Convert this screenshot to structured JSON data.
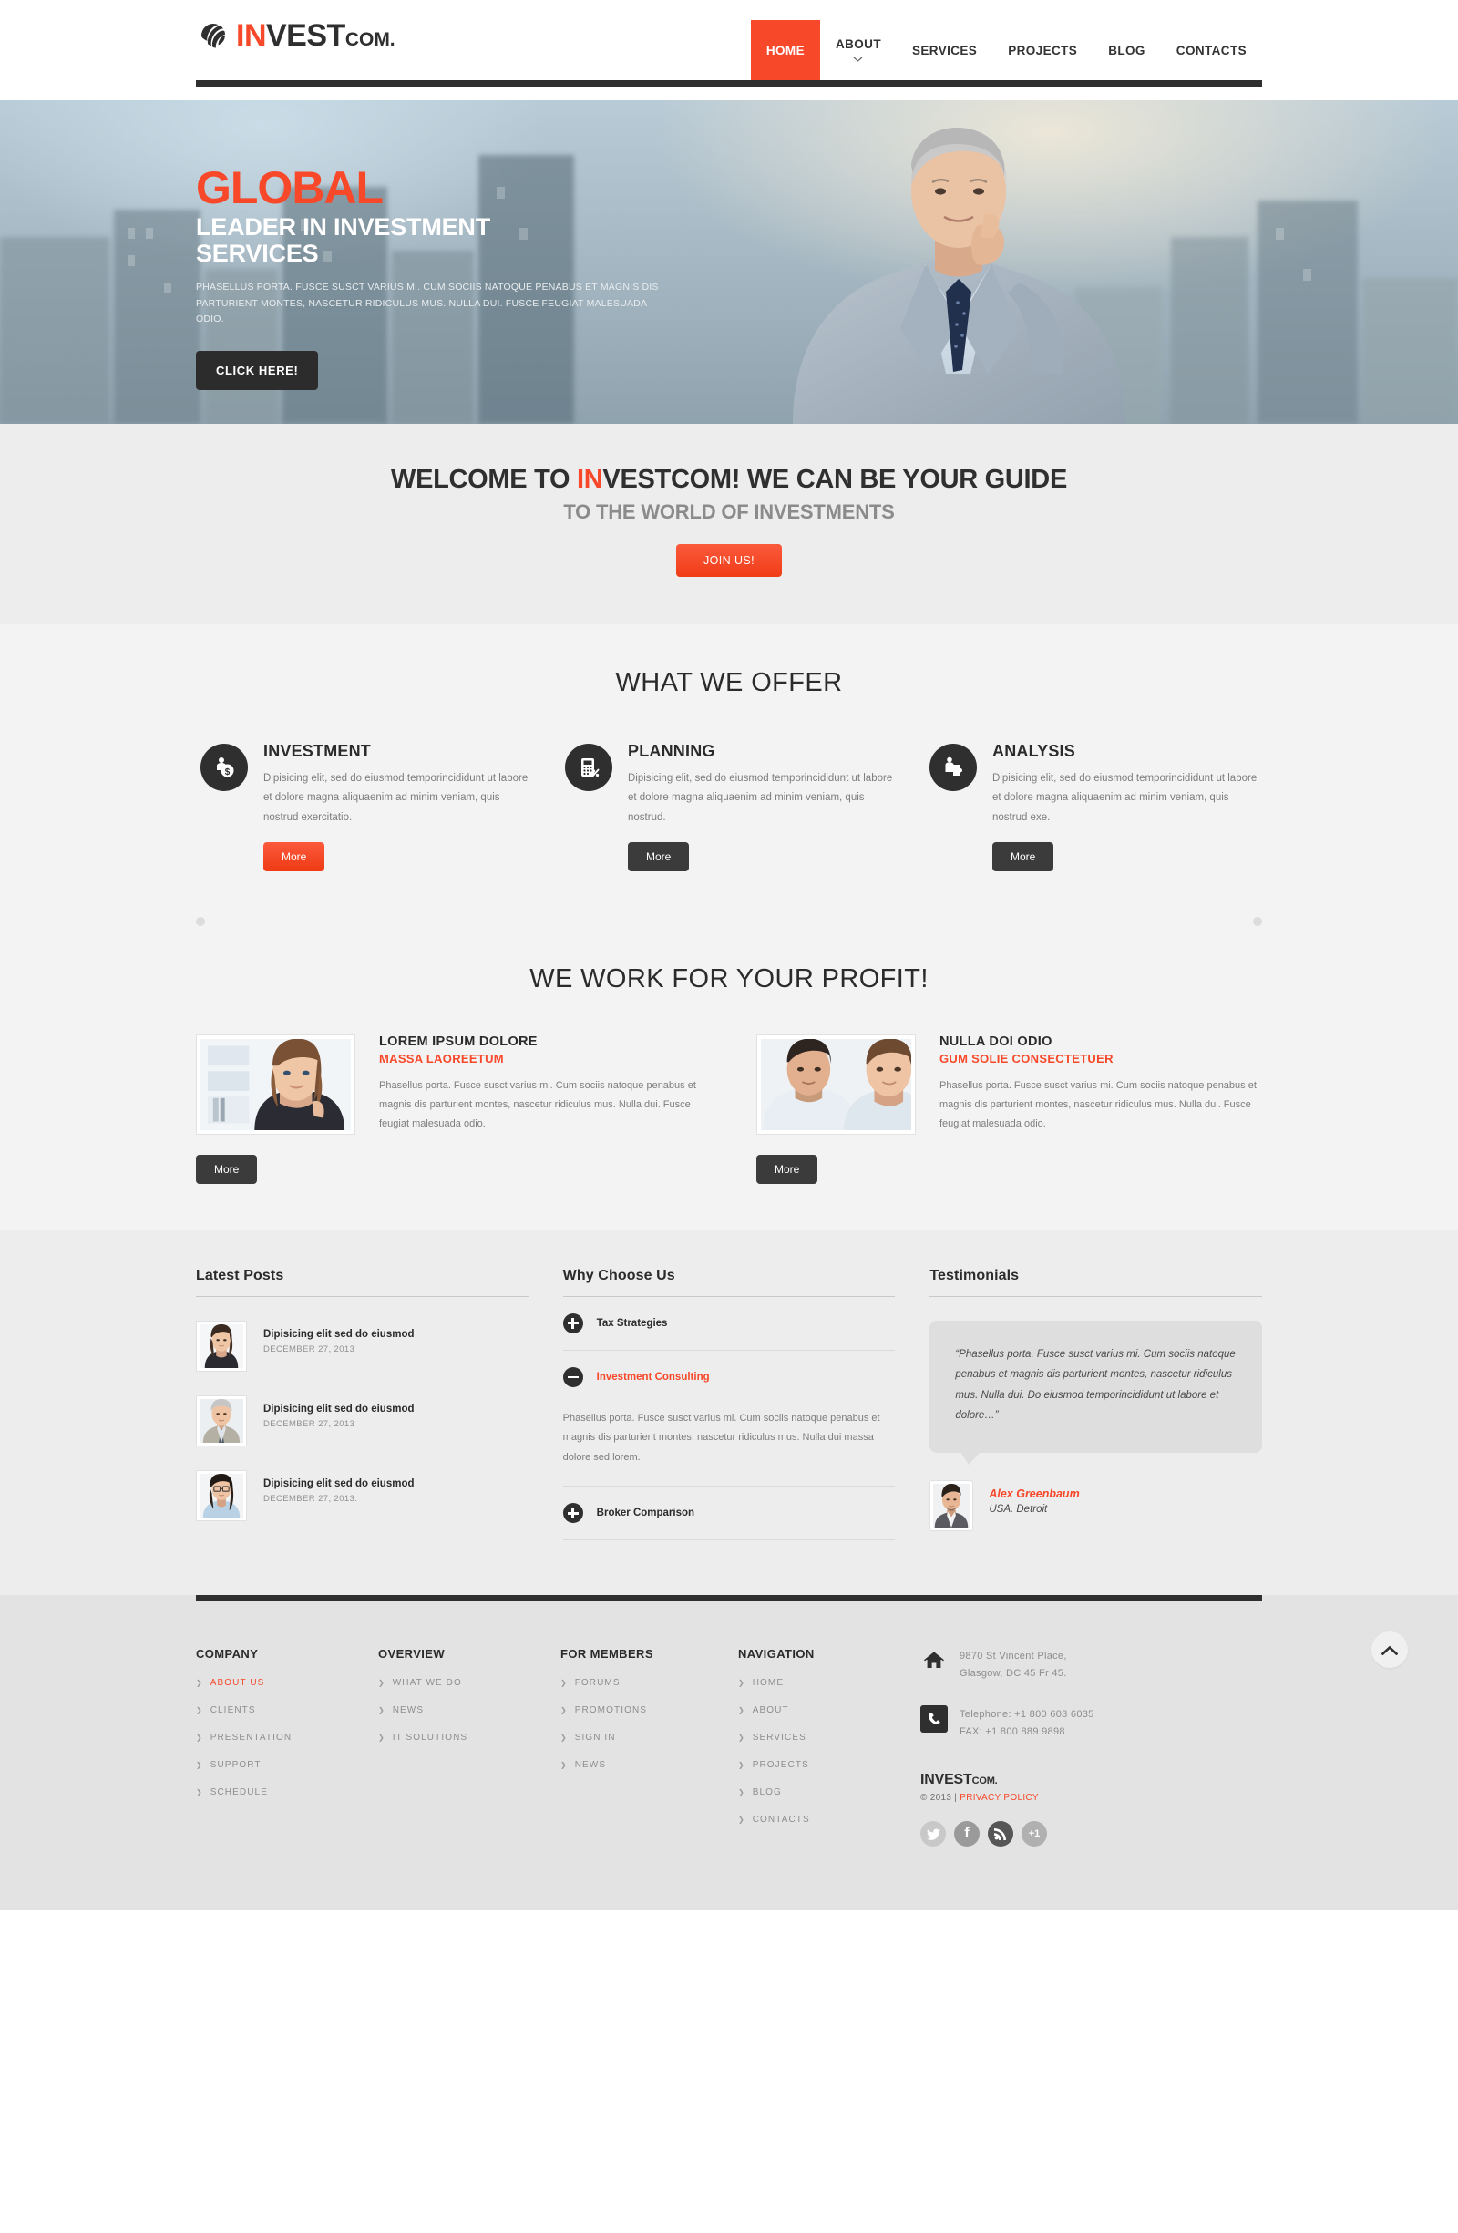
{
  "brand": {
    "name_accent": "IN",
    "name_rest": "VEST",
    "suffix": "COM."
  },
  "nav": {
    "items": [
      {
        "label": "HOME",
        "active": true,
        "dropdown": false
      },
      {
        "label": "ABOUT",
        "active": false,
        "dropdown": true
      },
      {
        "label": "SERVICES",
        "active": false,
        "dropdown": false
      },
      {
        "label": "PROJECTS",
        "active": false,
        "dropdown": false
      },
      {
        "label": "BLOG",
        "active": false,
        "dropdown": false
      },
      {
        "label": "CONTACTS",
        "active": false,
        "dropdown": false
      }
    ]
  },
  "hero": {
    "headline": "GLOBAL",
    "subhead_line1": "LEADER IN INVESTMENT",
    "subhead_line2": "SERVICES",
    "paragraph": "Phasellus porta. Fusce susct varius mi. Cum sociis natoque penabus et magnis dis parturient montes, nascetur ridiculus mus. Nulla dui. Fusce feugiat malesuada odio.",
    "button": "CLICK HERE!"
  },
  "welcome": {
    "title_pre": "WELCOME TO ",
    "title_accent": "IN",
    "title_post": "VESTCOM! WE CAN BE YOUR GUIDE",
    "subtitle": "TO THE WORLD OF INVESTMENTS",
    "button": "JOIN US!"
  },
  "offer": {
    "title": "WHAT WE OFFER",
    "items": [
      {
        "icon": "investment-icon",
        "title": "INVESTMENT",
        "text": "Dipisicing elit, sed do eiusmod temporincididunt ut labore et dolore magna aliquaenim ad minim veniam, quis nostrud exercitatio.",
        "button": "More",
        "button_style": "red"
      },
      {
        "icon": "calculator-icon",
        "title": "PLANNING",
        "text": "Dipisicing elit, sed do eiusmod temporincididunt ut labore et dolore magna aliquaenim ad minim veniam, quis nostrud.",
        "button": "More",
        "button_style": "dark"
      },
      {
        "icon": "analysis-icon",
        "title": "ANALYSIS",
        "text": "Dipisicing elit, sed do eiusmod temporincididunt ut labore et dolore magna aliquaenim ad minim veniam, quis nostrud exe.",
        "button": "More",
        "button_style": "dark"
      }
    ]
  },
  "profit": {
    "title": "WE WORK FOR YOUR PROFIT!",
    "items": [
      {
        "image": "businesswoman-photo",
        "title": "LOREM IPSUM DOLORE",
        "subtitle": "MASSA LAOREETUM",
        "text": "Phasellus porta. Fusce susct varius mi. Cum sociis natoque penabus et magnis dis parturient montes, nascetur ridiculus mus. Nulla dui. Fusce feugiat malesuada odio.",
        "button": "More"
      },
      {
        "image": "business-team-photo",
        "title": "NULLA DOI ODIO",
        "subtitle": "GUM SOLIE CONSECTETUER",
        "text": "Phasellus porta. Fusce susct varius mi. Cum sociis natoque penabus et magnis dis parturient montes, nascetur ridiculus mus. Nulla dui. Fusce feugiat malesuada odio.",
        "button": "More"
      }
    ]
  },
  "latest_posts": {
    "heading": "Latest Posts",
    "items": [
      {
        "image": "woman-dark-hair-photo",
        "title": "Dipisicing elit sed do eiusmod",
        "date": "DECEMBER 27, 2013"
      },
      {
        "image": "grey-haired-man-photo",
        "title": "Dipisicing elit sed do eiusmod",
        "date": "DECEMBER 27, 2013"
      },
      {
        "image": "woman-glasses-photo",
        "title": "Dipisicing elit sed do eiusmod",
        "date": "DECEMBER 27, 2013."
      }
    ]
  },
  "why_choose_us": {
    "heading": "Why Choose Us",
    "items": [
      {
        "label": "Tax Strategies",
        "open": false,
        "body": ""
      },
      {
        "label": "Investment Consulting",
        "open": true,
        "body": "Phasellus porta. Fusce susct varius mi. Cum sociis natoque penabus et magnis dis parturient montes, nascetur ridiculus mus. Nulla dui massa dolore sed lorem."
      },
      {
        "label": "Broker Comparison",
        "open": false,
        "body": ""
      }
    ]
  },
  "testimonials": {
    "heading": "Testimonials",
    "quote": "“Phasellus porta. Fusce susct varius mi. Cum sociis natoque penabus et magnis dis parturient montes, nascetur ridiculus mus. Nulla dui. Do eiusmod temporincididunt ut labore et dolore…”",
    "author_image": "man-suit-photo",
    "author_name": "Alex Greenbaum",
    "author_location": "USA. Detroit"
  },
  "footer": {
    "columns": [
      {
        "title": "COMPANY",
        "links": [
          {
            "label": "ABOUT US",
            "active": true
          },
          {
            "label": "CLIENTS",
            "active": false
          },
          {
            "label": "PRESENTATION",
            "active": false
          },
          {
            "label": "SUPPORT",
            "active": false
          },
          {
            "label": "SCHEDULE",
            "active": false
          }
        ]
      },
      {
        "title": "OVERVIEW",
        "links": [
          {
            "label": "WHAT WE DO",
            "active": false
          },
          {
            "label": "NEWS",
            "active": false
          },
          {
            "label": "IT SOLUTIONS",
            "active": false
          }
        ]
      },
      {
        "title": "FOR MEMBERS",
        "links": [
          {
            "label": "FORUMS",
            "active": false
          },
          {
            "label": "PROMOTIONS",
            "active": false
          },
          {
            "label": "SIGN IN",
            "active": false
          },
          {
            "label": "NEWS",
            "active": false
          }
        ]
      },
      {
        "title": "NAVIGATION",
        "links": [
          {
            "label": "HOME",
            "active": false
          },
          {
            "label": "ABOUT",
            "active": false
          },
          {
            "label": "SERVICES",
            "active": false
          },
          {
            "label": "PROJECTS",
            "active": false
          },
          {
            "label": "BLOG",
            "active": false
          },
          {
            "label": "CONTACTS",
            "active": false
          }
        ]
      }
    ],
    "contact": {
      "address_line1": "9870 St Vincent Place,",
      "address_line2": "Glasgow, DC 45 Fr 45.",
      "telephone": "Telephone: +1 800 603 6035",
      "fax": "FAX: +1 800 889 9898"
    },
    "logo_accent": "INVEST",
    "logo_suffix": "COM.",
    "copyright": "© 2013 | ",
    "privacy": "PRIVACY POLICY",
    "socials": [
      {
        "name": "twitter-icon",
        "glyph": "🐦",
        "color": "#c8c8c8"
      },
      {
        "name": "facebook-icon",
        "glyph": "f",
        "color": "#9a9a9a"
      },
      {
        "name": "rss-icon",
        "glyph": "◜",
        "color": "#565656"
      },
      {
        "name": "google-plus-icon",
        "glyph": "+1",
        "color": "#b0b0b0"
      }
    ]
  },
  "colors": {
    "accent": "#f8482a",
    "dark": "#2f2f2f",
    "muted": "#8d8d8d"
  }
}
